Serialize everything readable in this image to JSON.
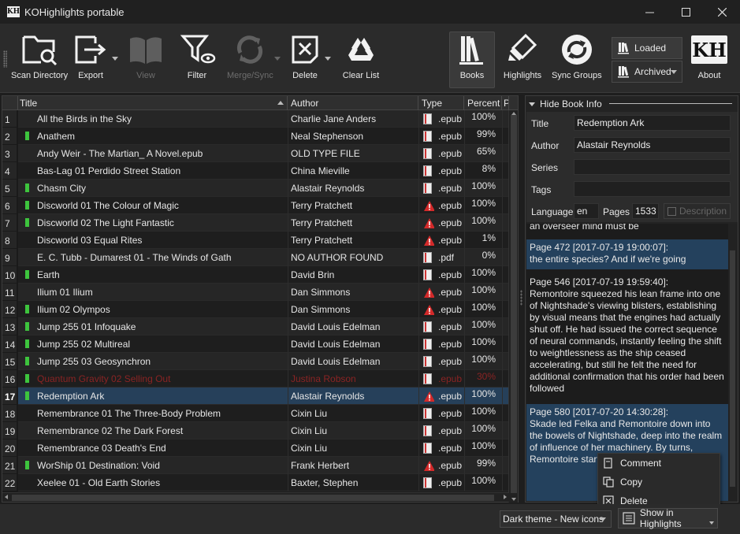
{
  "window": {
    "title": "KOHighlights portable",
    "icon_text": "KH",
    "controls": [
      "minimize-icon",
      "maximize-icon",
      "close-icon"
    ]
  },
  "toolbar": {
    "scan_directory": "Scan Directory",
    "export": "Export",
    "view": "View",
    "filter": "Filter",
    "merge_sync": "Merge/Sync",
    "delete": "Delete",
    "clear_list": "Clear List",
    "books": "Books",
    "highlights": "Highlights",
    "sync_groups": "Sync Groups",
    "loaded": "Loaded",
    "archived": "Archived",
    "about": "About",
    "about_logo": "KH"
  },
  "table": {
    "columns": [
      "Title",
      "Author",
      "Type",
      "Percent",
      "P"
    ],
    "sorted_column": "Title",
    "rows": [
      {
        "n": "1",
        "title": "All the Birds in the Sky",
        "author": "Charlie Jane Anders",
        "type": ".epub",
        "pct": "100%",
        "bookmark": false,
        "icon": "book"
      },
      {
        "n": "2",
        "title": "Anathem",
        "author": "Neal Stephenson",
        "type": ".epub",
        "pct": "99%",
        "bookmark": true,
        "icon": "book"
      },
      {
        "n": "3",
        "title": "Andy Weir - The Martian_ A Novel.epub",
        "author": "OLD TYPE FILE",
        "type": ".epub",
        "pct": "65%",
        "bookmark": false,
        "icon": "book"
      },
      {
        "n": "4",
        "title": "Bas-Lag 01 Perdido Street Station",
        "author": "China Mieville",
        "type": ".epub",
        "pct": "8%",
        "bookmark": false,
        "icon": "book"
      },
      {
        "n": "5",
        "title": "Chasm City",
        "author": "Alastair Reynolds",
        "type": ".epub",
        "pct": "100%",
        "bookmark": true,
        "icon": "book"
      },
      {
        "n": "6",
        "title": "Discworld 01 The Colour of Magic",
        "author": "Terry Pratchett",
        "type": ".epub",
        "pct": "100%",
        "bookmark": true,
        "icon": "warning"
      },
      {
        "n": "7",
        "title": "Discworld 02 The Light Fantastic",
        "author": "Terry Pratchett",
        "type": ".epub",
        "pct": "100%",
        "bookmark": true,
        "icon": "warning"
      },
      {
        "n": "8",
        "title": "Discworld 03 Equal Rites",
        "author": "Terry Pratchett",
        "type": ".epub",
        "pct": "1%",
        "bookmark": false,
        "icon": "warning"
      },
      {
        "n": "9",
        "title": "E. C. Tubb - Dumarest 01 - The Winds of Gath",
        "author": "NO AUTHOR FOUND",
        "type": ".pdf",
        "pct": "0%",
        "bookmark": false,
        "icon": "book"
      },
      {
        "n": "10",
        "title": "Earth",
        "author": "David Brin",
        "type": ".epub",
        "pct": "100%",
        "bookmark": true,
        "icon": "book"
      },
      {
        "n": "11",
        "title": "Ilium 01 Ilium",
        "author": "Dan Simmons",
        "type": ".epub",
        "pct": "100%",
        "bookmark": false,
        "icon": "warning"
      },
      {
        "n": "12",
        "title": "Ilium 02 Olympos",
        "author": "Dan Simmons",
        "type": ".epub",
        "pct": "100%",
        "bookmark": true,
        "icon": "warning"
      },
      {
        "n": "13",
        "title": "Jump 255 01 Infoquake",
        "author": "David Louis Edelman",
        "type": ".epub",
        "pct": "100%",
        "bookmark": true,
        "icon": "book"
      },
      {
        "n": "14",
        "title": "Jump 255 02 Multireal",
        "author": "David Louis Edelman",
        "type": ".epub",
        "pct": "100%",
        "bookmark": true,
        "icon": "book"
      },
      {
        "n": "15",
        "title": "Jump 255 03 Geosynchron",
        "author": "David Louis Edelman",
        "type": ".epub",
        "pct": "100%",
        "bookmark": true,
        "icon": "book"
      },
      {
        "n": "16",
        "title": "Quantum Gravity 02 Selling Out",
        "author": "Justina Robson",
        "type": ".epub",
        "pct": "30%",
        "bookmark": true,
        "icon": "book",
        "faded": true
      },
      {
        "n": "17",
        "title": "Redemption Ark",
        "author": "Alastair Reynolds",
        "type": ".epub",
        "pct": "100%",
        "bookmark": true,
        "icon": "warning",
        "selected": true
      },
      {
        "n": "18",
        "title": "Remembrance 01 The Three-Body Problem",
        "author": "Cixin Liu",
        "type": ".epub",
        "pct": "100%",
        "bookmark": false,
        "icon": "book"
      },
      {
        "n": "19",
        "title": "Remembrance 02 The Dark Forest",
        "author": "Cixin Liu",
        "type": ".epub",
        "pct": "100%",
        "bookmark": false,
        "icon": "book"
      },
      {
        "n": "20",
        "title": "Remembrance 03 Death's End",
        "author": "Cixin Liu",
        "type": ".epub",
        "pct": "100%",
        "bookmark": false,
        "icon": "book"
      },
      {
        "n": "21",
        "title": "WorShip 01 Destination: Void",
        "author": "Frank Herbert",
        "type": ".epub",
        "pct": "99%",
        "bookmark": true,
        "icon": "warning"
      },
      {
        "n": "22",
        "title": "Xeelee 01 - Old Earth Stories",
        "author": "Baxter, Stephen",
        "type": ".epub",
        "pct": "100%",
        "bookmark": false,
        "icon": "book"
      }
    ]
  },
  "info": {
    "toggle_label": "Hide Book Info",
    "title_label": "Title",
    "title_value": "Redemption Ark",
    "author_label": "Author",
    "author_value": "Alastair Reynolds",
    "series_label": "Series",
    "series_value": "",
    "tags_label": "Tags",
    "tags_value": "",
    "language_label": "Language",
    "language_value": "en",
    "pages_label": "Pages",
    "pages_value": "1533",
    "description_label": "Description"
  },
  "highlights": [
    {
      "header": "",
      "text": "an overseer mind must be",
      "selected": false
    },
    {
      "header": "Page 472 [2017-07-19 19:00:07]:",
      "text": "the entire species? And if we're going",
      "selected": true
    },
    {
      "header": "Page 546 [2017-07-19 19:59:40]:",
      "text": "Remontoire squeezed his lean frame into one of Nightshade's viewing blisters, establishing by visual means that the engines had actually shut off. He had issued the correct sequence of neural commands, instantly feeling the shift to weightlessness as the ship ceased accelerating, but still he felt the need for additional confirmation that his order had been followed",
      "selected": false
    },
    {
      "header": "Page 580 [2017-07-20 14:30:28]:",
      "text": "Skade led Felka and Remontoire down into the bowels of Nightshade, deep into the realm of influence of her machinery. By turns, Remontoire start feverish. At first imagination",
      "selected": true
    }
  ],
  "context_menu": {
    "comment": "Comment",
    "copy": "Copy",
    "delete": "Delete"
  },
  "status": {
    "theme": "Dark theme - New icons",
    "show_in_highlights": "Show in Highlights"
  },
  "colors": {
    "accent_selection": "#26405a",
    "bookmark_green": "#3dc43d",
    "warning_red": "#d42a2a"
  }
}
